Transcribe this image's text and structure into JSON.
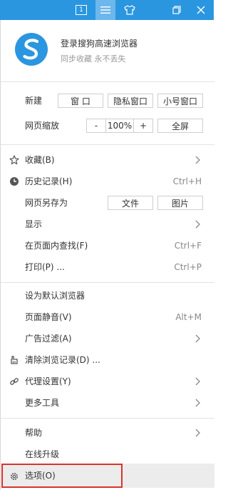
{
  "titlebar": {
    "tab_count": "1",
    "icons": [
      "tab-count-icon",
      "menu-icon",
      "skin-icon",
      "restore-icon",
      "close-icon"
    ]
  },
  "profile": {
    "title": "登录搜狗高速浏览器",
    "subtitle": "同步收藏 永不丢失"
  },
  "new": {
    "label": "新建",
    "window": "窗 口",
    "private": "隐私窗口",
    "small": "小号窗口"
  },
  "zoom": {
    "label": "网页缩放",
    "minus": "-",
    "value": "100%",
    "plus": "+",
    "fullscreen": "全屏"
  },
  "items": {
    "favorites": "收藏(B)",
    "history": "历史记录(H)",
    "history_shortcut": "Ctrl+H",
    "save_as": "网页另存为",
    "save_file": "文件",
    "save_image": "图片",
    "display": "显示",
    "find": "在页面内查找(F)",
    "find_shortcut": "Ctrl+F",
    "print": "打印(P) ...",
    "print_shortcut": "Ctrl+P",
    "default_browser": "设为默认浏览器",
    "mute": "页面静音(V)",
    "mute_shortcut": "Alt+M",
    "adblock": "广告过滤(A)",
    "clear": "清除浏览记录(D) ...",
    "proxy": "代理设置(Y)",
    "more_tools": "更多工具",
    "help": "帮助",
    "upgrade": "在线升级",
    "options": "选项(O)"
  },
  "colors": {
    "titlebar": "#2b96e0",
    "highlight_border": "#d9342b",
    "logo": "#2b96e0"
  }
}
